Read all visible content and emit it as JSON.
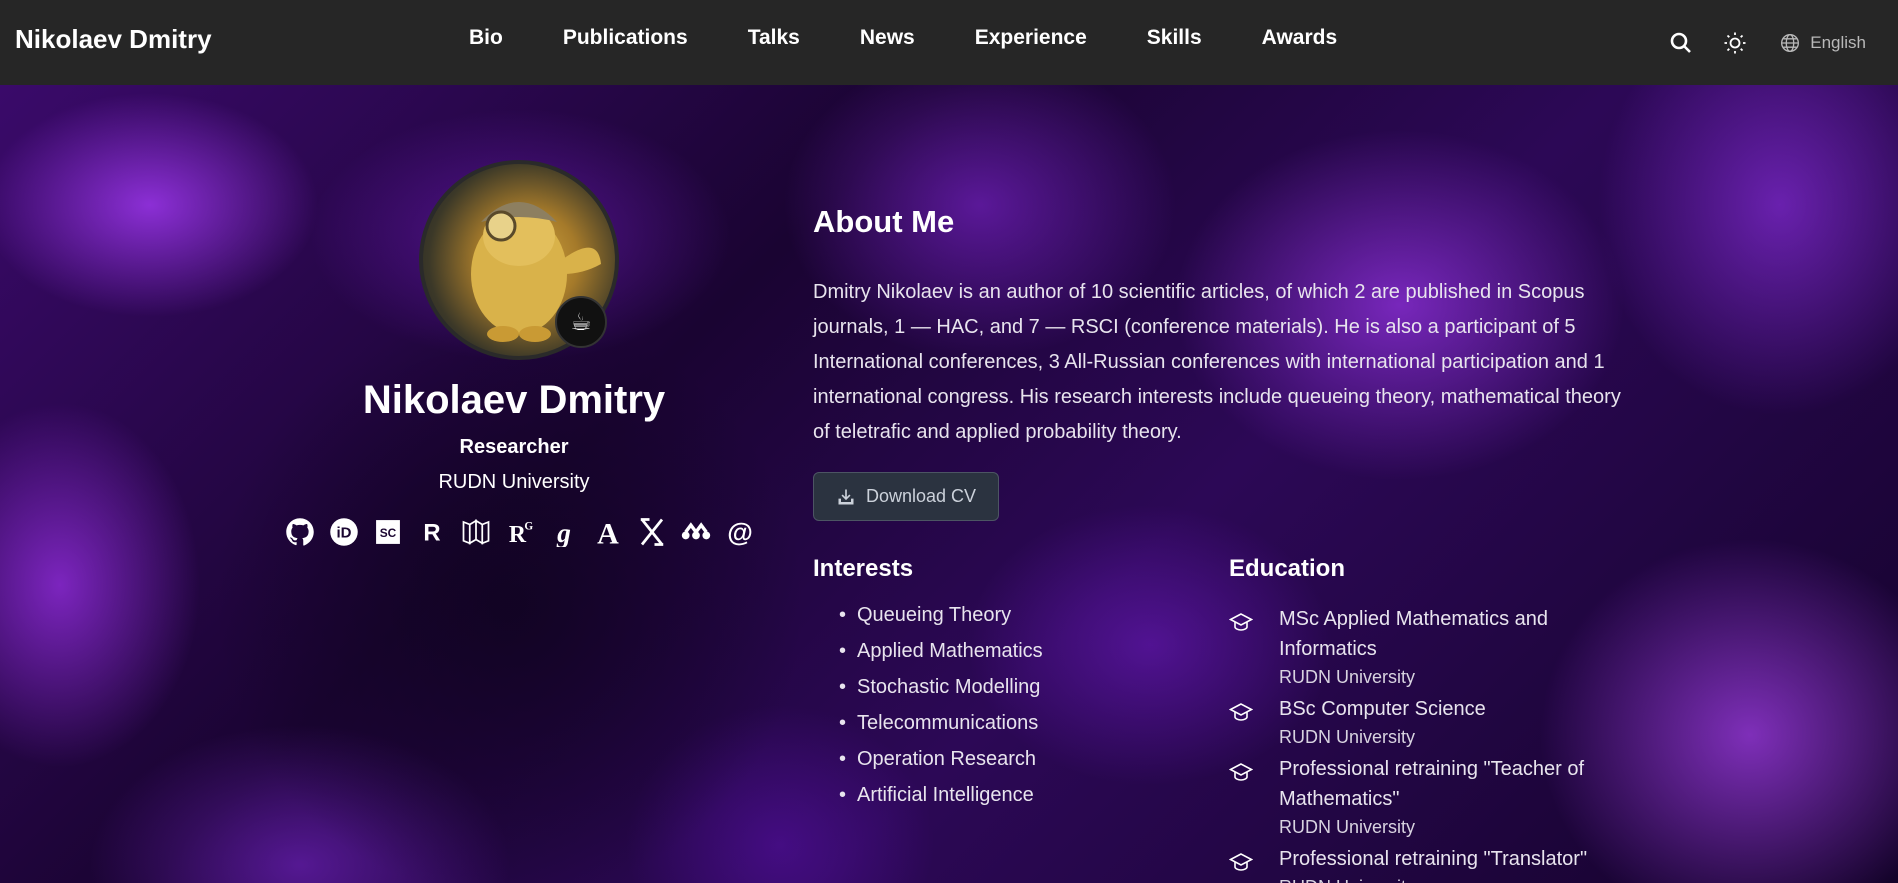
{
  "brand": "Nikolaev Dmitry",
  "nav": [
    "Bio",
    "Publications",
    "Talks",
    "News",
    "Experience",
    "Skills",
    "Awards"
  ],
  "nav_right": {
    "search_icon": "search-icon",
    "theme_icon": "sun-icon",
    "language": "English"
  },
  "profile": {
    "name": "Nikolaev Dmitry",
    "role": "Researcher",
    "organization": "RUDN University",
    "badge": "☕",
    "socials": [
      "github",
      "orcid",
      "scopus",
      "researcherid",
      "wos",
      "researchgate",
      "google-scholar",
      "academia",
      "x",
      "mendeley",
      "email"
    ]
  },
  "about": {
    "title": "About Me",
    "text": "Dmitry Nikolaev is an author of 10 scientific articles, of which 2 are published in Scopus journals, 1 — HAC, and 7 — RSCI (conference materials). He is also a participant of 5 International conferences, 3 All-Russian conferences with international participation and 1 international congress. His research interests include queueing theory, mathematical theory of teletrafic and applied probability theory.",
    "cv_label": "Download CV"
  },
  "interests": {
    "title": "Interests",
    "items": [
      "Queueing Theory",
      "Applied Mathematics",
      "Stochastic Modelling",
      "Telecommunications",
      "Operation Research",
      "Artificial Intelligence"
    ]
  },
  "education": {
    "title": "Education",
    "items": [
      {
        "degree": "MSc Applied Mathematics and Informatics",
        "institution": "RUDN University"
      },
      {
        "degree": "BSc Computer Science",
        "institution": "RUDN University"
      },
      {
        "degree": "Professional retraining \"Teacher of Mathematics\"",
        "institution": "RUDN University"
      },
      {
        "degree": "Professional retraining \"Translator\"",
        "institution": "RUDN University"
      }
    ]
  }
}
